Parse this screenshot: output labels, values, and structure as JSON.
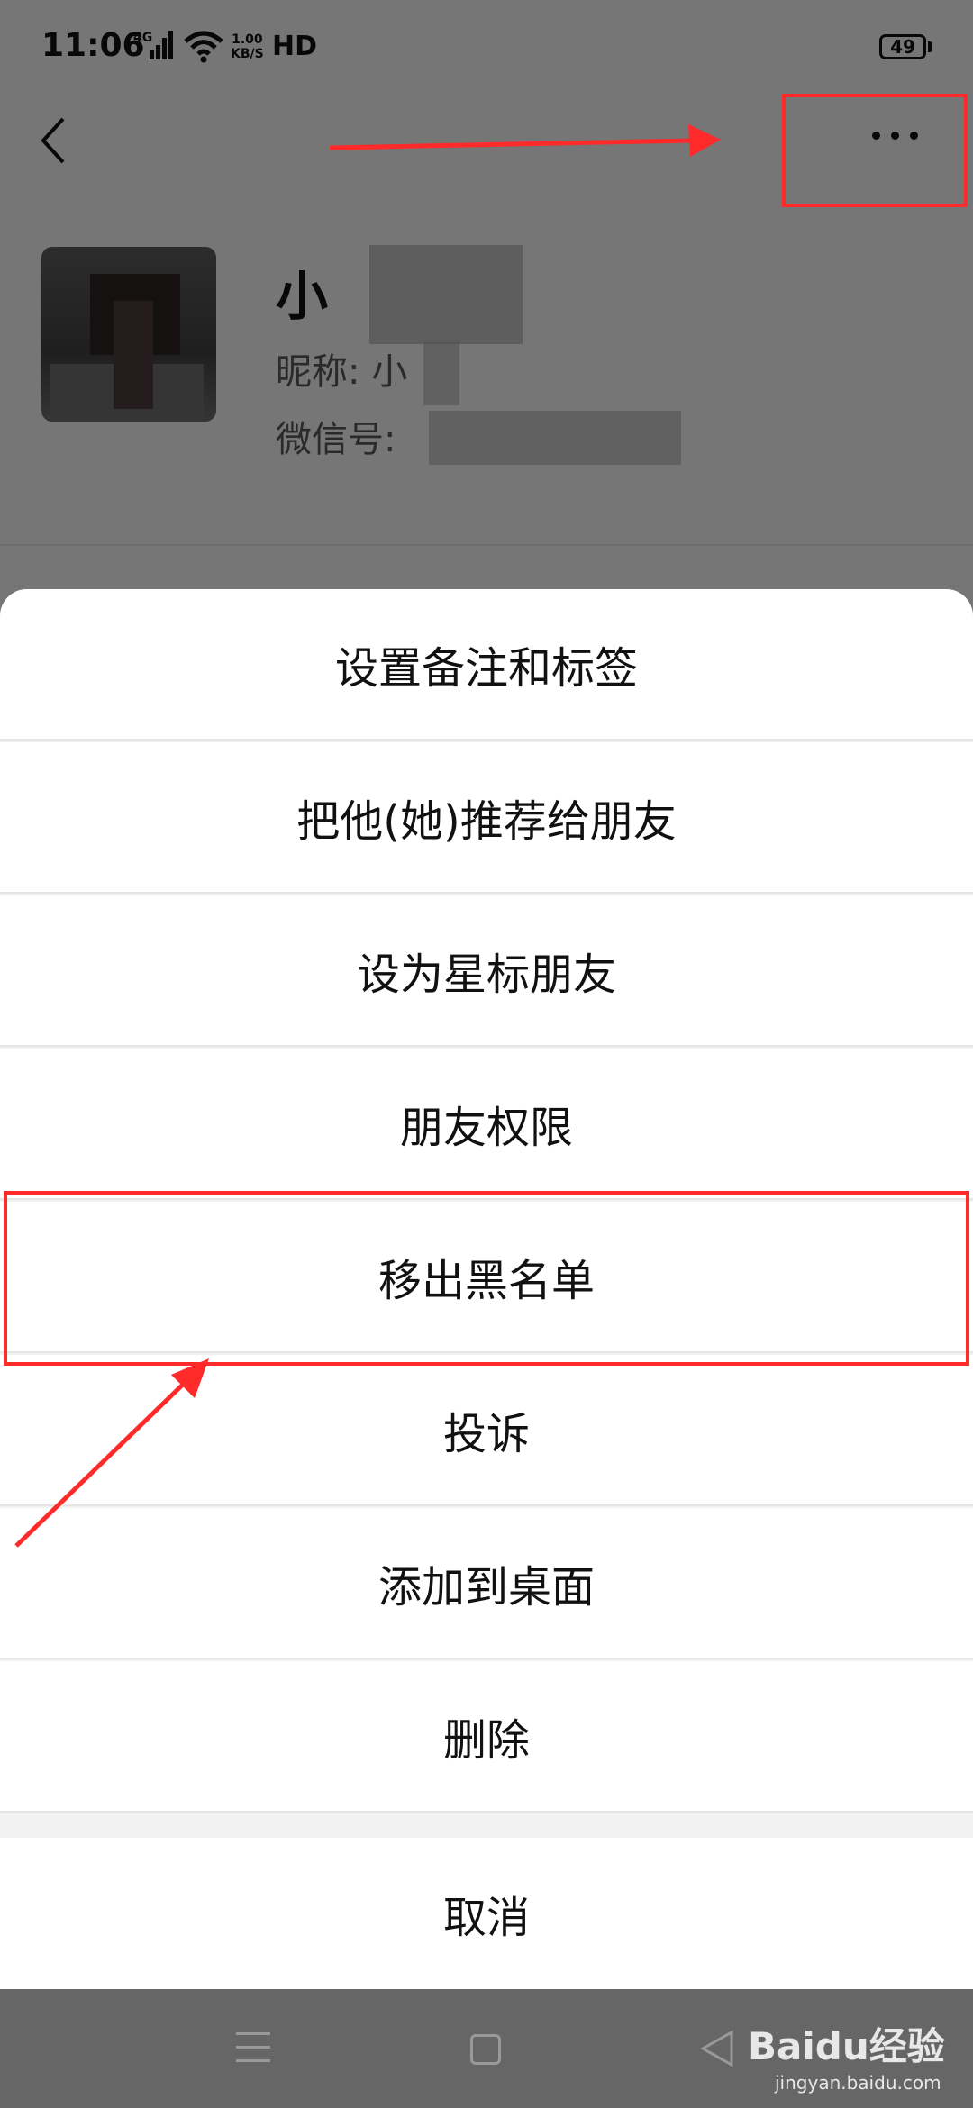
{
  "status_bar": {
    "time": "11:06",
    "network": "4G",
    "speed_value": "1.00",
    "speed_unit": "KB/S",
    "hd": "HD",
    "battery": "49"
  },
  "header": {
    "back_icon": "chevron-left-icon",
    "more_icon": "more-dots-icon"
  },
  "profile": {
    "name": "小",
    "nickname_label": "昵称: 小",
    "wechat_id_label": "微信号:"
  },
  "action_sheet": {
    "items": [
      "设置备注和标签",
      "把他(她)推荐给朋友",
      "设为星标朋友",
      "朋友权限",
      "移出黑名单",
      "投诉",
      "添加到桌面",
      "删除"
    ],
    "cancel": "取消"
  },
  "nav_bar": {
    "menu_icon": "menu-icon",
    "home_icon": "home-icon",
    "back_icon": "back-triangle-icon"
  },
  "watermark": {
    "brand": "Baidu经验",
    "url": "jingyan.baidu.com"
  },
  "annotation_color": "#ff2a2a"
}
